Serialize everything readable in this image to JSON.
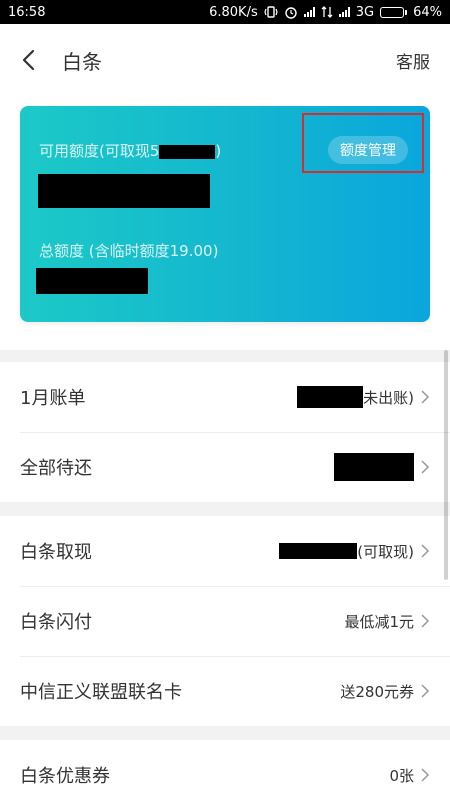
{
  "status_bar": {
    "time": "16:58",
    "network_speed": "6.80K/s",
    "network_type": "3G",
    "battery_percent": "64%",
    "battery_level": 0.64
  },
  "nav": {
    "title": "白条",
    "right_label": "客服"
  },
  "card": {
    "available_label_prefix": "可用额度(可取现5",
    "available_label_suffix": ")",
    "manage_button": "额度管理",
    "total_label": "总额度 (含临时额度19.00)",
    "gradient_start": "#1cc9c7",
    "gradient_end": "#0aa6dd",
    "highlight_color": "#d32f2f"
  },
  "rows": {
    "bill": {
      "label": "1月账单",
      "value_suffix": "未出账)"
    },
    "pending": {
      "label": "全部待还"
    },
    "cash": {
      "label": "白条取现",
      "value_suffix": "(可取现)"
    },
    "flash_pay": {
      "label": "白条闪付",
      "value": "最低减1元"
    },
    "co_card": {
      "label": "中信正义联盟联名卡",
      "value": "送280元券"
    },
    "coupons": {
      "label": "白条优惠券",
      "value": "0张"
    }
  }
}
